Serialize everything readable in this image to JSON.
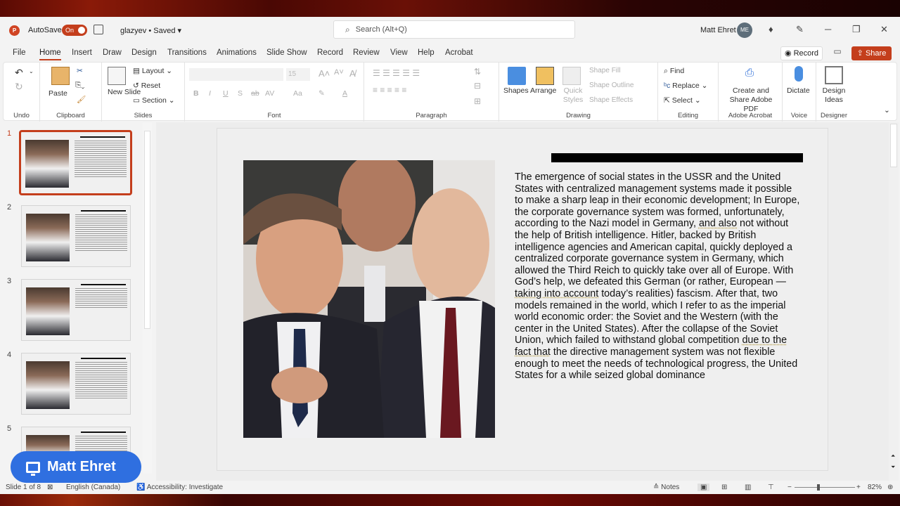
{
  "titlebar": {
    "app_icon": "P",
    "autosave_label": "AutoSave",
    "autosave_state": "On",
    "doc_name": "glazyev • Saved",
    "doc_dropdown": "▾",
    "search_placeholder": "Search (Alt+Q)",
    "user_name": "Matt Ehret",
    "user_initials": "ME",
    "icons": {
      "diamond": "♦",
      "pen": "✎",
      "minimize": "─",
      "restore": "❐",
      "close": "✕"
    }
  },
  "menu": {
    "items": [
      "File",
      "Home",
      "Insert",
      "Draw",
      "Design",
      "Transitions",
      "Animations",
      "Slide Show",
      "Record",
      "Review",
      "View",
      "Help",
      "Acrobat"
    ],
    "active": "Home",
    "record_label": "Record",
    "share_label": "Share"
  },
  "ribbon": {
    "groups": {
      "undo": "Undo",
      "clipboard": "Clipboard",
      "slides": "Slides",
      "font": "Font",
      "paragraph": "Paragraph",
      "drawing": "Drawing",
      "editing": "Editing",
      "adobe": "Adobe Acrobat",
      "voice": "Voice",
      "designer": "Designer"
    },
    "paste": "Paste",
    "new_slide": "New Slide",
    "layout": "Layout",
    "reset": "Reset",
    "section": "Section",
    "font_size": "15",
    "font_buttons": [
      "B",
      "I",
      "U",
      "S",
      "ab",
      "AV",
      "Aa"
    ],
    "shapes": "Shapes",
    "arrange": "Arrange",
    "quick_styles": "Quick Styles",
    "shape_fill": "Shape Fill",
    "shape_outline": "Shape Outline",
    "shape_effects": "Shape Effects",
    "find": "Find",
    "replace": "Replace",
    "select": "Select",
    "create_share_pdf": "Create and Share Adobe PDF",
    "dictate": "Dictate",
    "design_ideas": "Design Ideas"
  },
  "thumbnails": [
    {
      "number": "1",
      "selected": true
    },
    {
      "number": "2",
      "selected": false
    },
    {
      "number": "3",
      "selected": false
    },
    {
      "number": "4",
      "selected": false
    },
    {
      "number": "5",
      "selected": false
    }
  ],
  "slide": {
    "text_parts": [
      "The emergence of social states in the USSR and the United States with centralized management systems made it possible to make a sharp leap in their economic development; In Europe, the corporate governance system was formed, unfortunately, according to the Nazi model in Germany, ",
      "and also",
      " not without the help of British intelligence. Hitler, backed by British intelligence agencies and American capital, quickly deployed a centralized corporate governance system in Germany, which allowed the Third Reich to quickly take over all of Europe. With God’s help, we defeated this German (or rather, European — ",
      "taking into account",
      " today’s realities) fascism. After that, two models remained in the world, which I refer to as the imperial world economic order: the Soviet and the Western (with the center in the United States). After the collapse of the Soviet Union, which failed to withstand global competition ",
      "due to the fact that",
      " the directive management system was not flexible enough to meet the needs of technological progress, the United States for a while seized global dominance"
    ]
  },
  "status": {
    "slide_count": "Slide 1 of 8",
    "language": "English (Canada)",
    "accessibility": "Accessibility: Investigate",
    "notes": "Notes",
    "zoom": "82%",
    "zoom_minus": "−",
    "zoom_plus": "+"
  },
  "overlay": {
    "presenter_name": "Matt Ehret"
  },
  "colors": {
    "accent": "#c43e1c",
    "overlay_blue": "#2f6fe0"
  }
}
